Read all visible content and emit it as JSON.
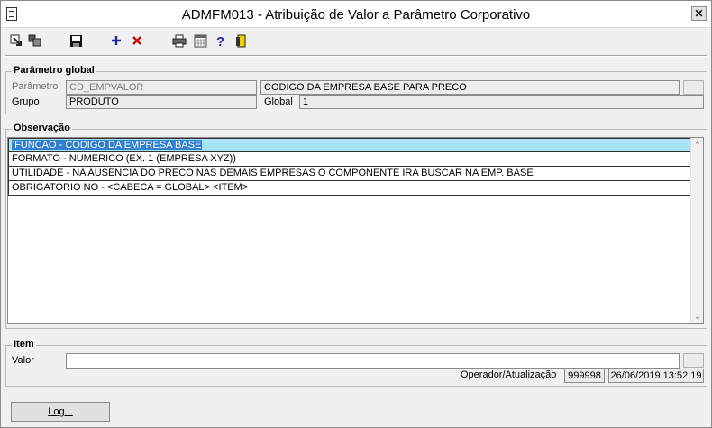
{
  "window": {
    "title": "ADMFM013 - Atribuição de Valor a Parâmetro Corporativo",
    "close_label": "✕"
  },
  "toolbar": {
    "icons": [
      "export-icon",
      "copy-icon",
      "save-icon",
      "add-icon",
      "delete-icon",
      "print-icon",
      "calculator-icon",
      "help-icon",
      "exit-icon"
    ]
  },
  "parametro_global": {
    "title": "Parâmetro global",
    "parametro_label": "Parâmetro",
    "parametro_value": "CD_EMPVALOR",
    "descricao_value": "CODIGO DA EMPRESA BASE PARA PRECO",
    "grupo_label": "Grupo",
    "grupo_value": "PRODUTO",
    "global_label": "Global",
    "global_value": "1"
  },
  "observacao": {
    "title": "Observação",
    "lines": [
      "'FUNCAO - CODIGO DA EMPRESA BASE",
      "FORMATO - NUMERICO (EX. 1 (EMPRESA XYZ))",
      "UTILIDADE - NA AUSENCIA DO PRECO NAS DEMAIS EMPRESAS O COMPONENTE IRA BUSCAR NA EMP. BASE",
      "OBRIGATORIO NO - <CABECA = GLOBAL>  <ITEM>"
    ]
  },
  "item": {
    "title": "Item",
    "valor_label": "Valor",
    "valor_value": "",
    "operador_label": "Operador/Atualização",
    "operador_value": "999998",
    "data_value": "26/06/2019 13:52:19"
  },
  "footer": {
    "log_label": "Log..."
  },
  "colors": {
    "selection_row": "#a6e4f6",
    "selection_text_bg": "#2f7fd2",
    "add_icon": "#1a2aa0",
    "delete_icon": "#d01010"
  }
}
